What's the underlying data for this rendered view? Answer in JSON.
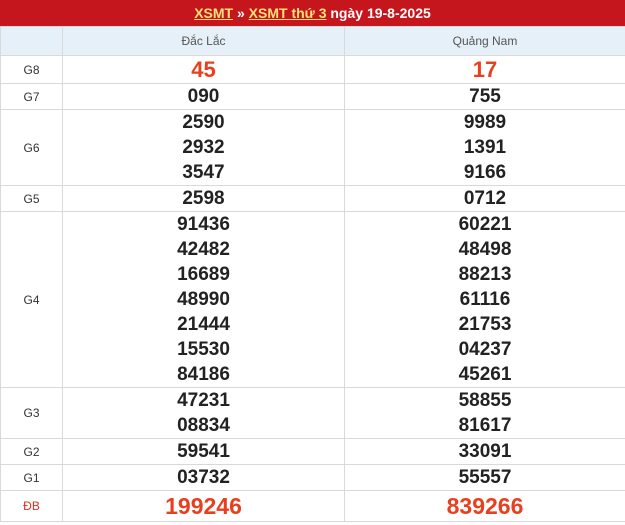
{
  "header": {
    "link1": "XSMT",
    "separator": "»",
    "link2": "XSMT thứ 3",
    "rest": "ngày 19-8-2025"
  },
  "columns": [
    "",
    "Đắc Lắc",
    "Quảng Nam"
  ],
  "rows": [
    {
      "label": "G8",
      "cells": [
        [
          "45"
        ],
        [
          "17"
        ]
      ]
    },
    {
      "label": "G7",
      "cells": [
        [
          "090"
        ],
        [
          "755"
        ]
      ]
    },
    {
      "label": "G6",
      "cells": [
        [
          "2590",
          "2932",
          "3547"
        ],
        [
          "9989",
          "1391",
          "9166"
        ]
      ]
    },
    {
      "label": "G5",
      "cells": [
        [
          "2598"
        ],
        [
          "0712"
        ]
      ]
    },
    {
      "label": "G4",
      "cells": [
        [
          "91436",
          "42482",
          "16689",
          "48990",
          "21444",
          "15530",
          "84186"
        ],
        [
          "60221",
          "48498",
          "88213",
          "61116",
          "21753",
          "04237",
          "45261"
        ]
      ]
    },
    {
      "label": "G3",
      "cells": [
        [
          "47231",
          "08834"
        ],
        [
          "58855",
          "81617"
        ]
      ]
    },
    {
      "label": "G2",
      "cells": [
        [
          "59541"
        ],
        [
          "33091"
        ]
      ]
    },
    {
      "label": "G1",
      "cells": [
        [
          "03732"
        ],
        [
          "55557"
        ]
      ]
    },
    {
      "label": "ĐB",
      "cells": [
        [
          "199246"
        ],
        [
          "839266"
        ]
      ]
    }
  ],
  "colors": {
    "header_bg": "#c4161c",
    "accent_number": "#e8401e",
    "link": "#ffe27a"
  }
}
